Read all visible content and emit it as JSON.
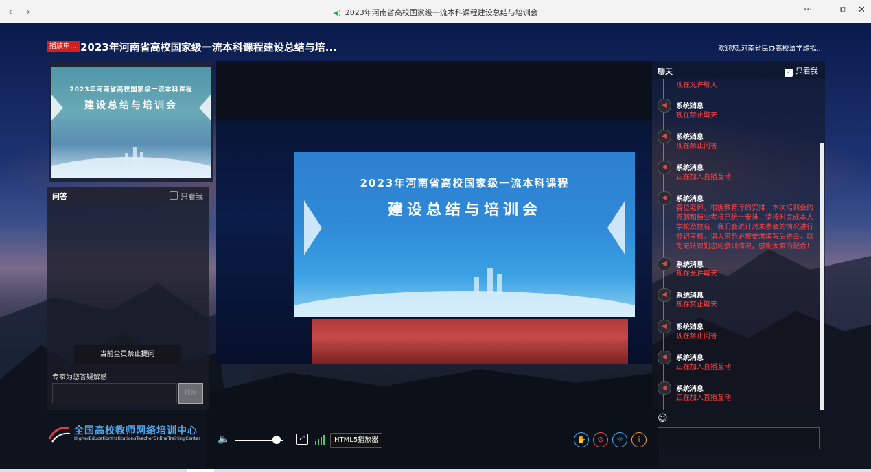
{
  "window": {
    "title": "2023年河南省高校国家级一流本科课程建设总结与培训会",
    "back_icon": "‹",
    "forward_icon": "›",
    "more_icon": "···",
    "minimize_icon": "–",
    "restore_icon": "⧉",
    "close_icon": "✕"
  },
  "header": {
    "live_badge": "播放中...",
    "title": "2023年河南省高校国家级一流本科课程建设总结与培...",
    "welcome": "欢迎您,河南省民办高校法学虚拟..."
  },
  "thumbnail": {
    "line1": "2023年河南省高校国家级一流本科课程",
    "line2": "建设总结与培训会"
  },
  "qa": {
    "title": "问答",
    "only_me": "只看我",
    "ban_notice": "当前全员禁止提问",
    "hint": "专家为您答疑解惑",
    "input_value": "",
    "submit": "提问"
  },
  "brand": {
    "name_cn": "全国高校教师网络培训中心",
    "name_en": "HigherEducationInstitutionsTeacherOnlineTrainingCenter"
  },
  "video": {
    "screen_line1": "2023年河南省高校国家级一流本科课程",
    "screen_line2": "建设总结与培训会"
  },
  "controls": {
    "volume_icon": "🔈",
    "volume_level": 0.85,
    "pip_icon": "⤢",
    "player_label": "HTML5播放器"
  },
  "chat": {
    "title": "聊天",
    "only_me": "只看我",
    "first_line": "现在允许聊天",
    "messages": [
      {
        "sender": "系统消息",
        "text": "现在禁止聊天"
      },
      {
        "sender": "系统消息",
        "text": "现在禁止问答"
      },
      {
        "sender": "系统消息",
        "text": "正在加入直播互动"
      },
      {
        "sender": "系统消息",
        "text": "各位老师，根据教育厅的安排，本次培训会的签到和结业考核已统一安排，请按时完成本人学校及姓名，我们会统计对未参会的情况进行登记考核，请大家务必按要求填写后进会，以免无法识别您的参训情况，感谢大家的配合！"
      },
      {
        "sender": "系统消息",
        "text": "现在允许聊天"
      },
      {
        "sender": "系统消息",
        "text": "现在禁止聊天"
      },
      {
        "sender": "系统消息",
        "text": "现在禁止问答"
      },
      {
        "sender": "系统消息",
        "text": "正在加入直播互动"
      },
      {
        "sender": "系统消息",
        "text": "正在加入直播互动"
      }
    ],
    "input_value": ""
  },
  "colors": {
    "live_badge": "#d41f1f",
    "chat_text": "#ff4545",
    "brand": "#4ea8f0",
    "hand_btn": "#36b6f2",
    "mic_btn": "#ff4a4a",
    "settings_btn": "#36b6f2",
    "info_btn": "#ff9a2e"
  }
}
